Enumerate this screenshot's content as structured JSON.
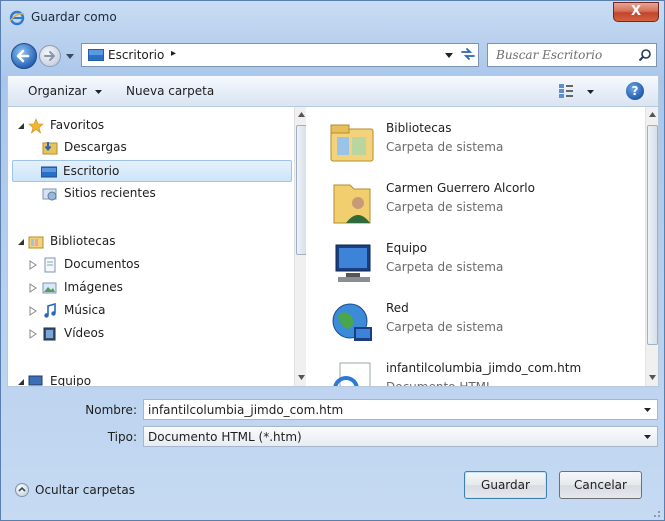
{
  "window": {
    "title": "Guardar como",
    "close_label": "X"
  },
  "address": {
    "location": "Escritorio",
    "separator": "▸"
  },
  "search": {
    "placeholder": "Buscar Escritorio"
  },
  "toolbar": {
    "organize_label": "Organizar",
    "new_folder_label": "Nueva carpeta",
    "help_label": "?"
  },
  "nav": {
    "favorites_label": "Favoritos",
    "favorites": [
      "Descargas",
      "Escritorio",
      "Sitios recientes"
    ],
    "libraries_label": "Bibliotecas",
    "libraries": [
      "Documentos",
      "Imágenes",
      "Música",
      "Vídeos"
    ],
    "computer_label": "Equipo"
  },
  "files": [
    {
      "name": "Bibliotecas",
      "type": "Carpeta de sistema",
      "icon": "libraries-icon"
    },
    {
      "name": "Carmen Guerrero Alcorlo",
      "type": "Carpeta de sistema",
      "icon": "user-folder-icon"
    },
    {
      "name": "Equipo",
      "type": "Carpeta de sistema",
      "icon": "computer-icon"
    },
    {
      "name": "Red",
      "type": "Carpeta de sistema",
      "icon": "network-icon"
    },
    {
      "name": "infantilcolumbia_jimdo_com.htm",
      "type": "Documento HTML",
      "icon": "html-document-icon"
    }
  ],
  "form": {
    "filename_label": "Nombre:",
    "filename_value": "infantilcolumbia_jimdo_com.htm",
    "type_label": "Tipo:",
    "type_value": "Documento HTML (*.htm)"
  },
  "footer": {
    "hide_folders_label": "Ocultar carpetas",
    "save_label": "Guardar",
    "cancel_label": "Cancelar"
  }
}
